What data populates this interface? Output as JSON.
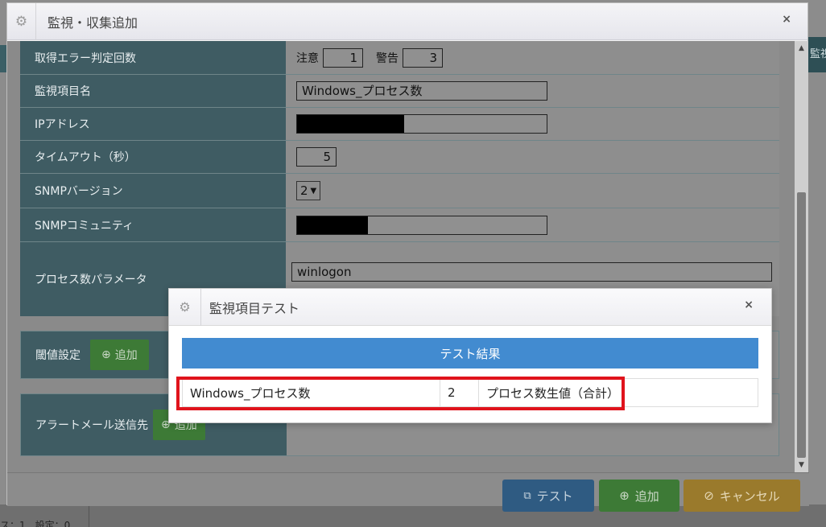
{
  "background": {
    "right_tab_label": "監視",
    "status_text": "ス：1　設定：0"
  },
  "dialog": {
    "title": "監視・収集追加",
    "close_label": "×",
    "rows": {
      "error_count": {
        "label": "取得エラー判定回数",
        "caution_label": "注意",
        "caution_value": "1",
        "warning_label": "警告",
        "warning_value": "3"
      },
      "item_name": {
        "label": "監視項目名",
        "value": "Windows_プロセス数"
      },
      "ip": {
        "label": "IPアドレス"
      },
      "timeout": {
        "label": "タイムアウト（秒）",
        "value": "5"
      },
      "snmp_version": {
        "label": "SNMPバージョン",
        "value": "2"
      },
      "snmp_community": {
        "label": "SNMPコミュニティ"
      },
      "process_param": {
        "label": "プロセス数パラメータ",
        "value": "winlogon"
      }
    },
    "threshold": {
      "label": "閾値設定",
      "add_label": "追加"
    },
    "alert_mail": {
      "label": "アラートメール送信先",
      "add_label": "追加"
    },
    "footer": {
      "test_label": "テスト",
      "add_label": "追加",
      "cancel_label": "キャンセル"
    }
  },
  "modal": {
    "title": "監視項目テスト",
    "close_label": "×",
    "result_header": "テスト結果",
    "result_row": {
      "name": "Windows_プロセス数",
      "value": "2",
      "description": "プロセス数生値（合計）"
    }
  },
  "colors": {
    "label_bg": "#3f5c63",
    "result_header_bg": "#428bd0",
    "highlight_border": "#e0131c",
    "test_button": "#2f5b82",
    "add_button": "#3d7a36",
    "cancel_button": "#9a7a2c"
  },
  "icons": {
    "dialog_gear": "gear-icon",
    "modal_gear": "gear-icon",
    "add": "plus-circle-icon",
    "test": "sitemap-icon",
    "cancel": "ban-icon"
  }
}
